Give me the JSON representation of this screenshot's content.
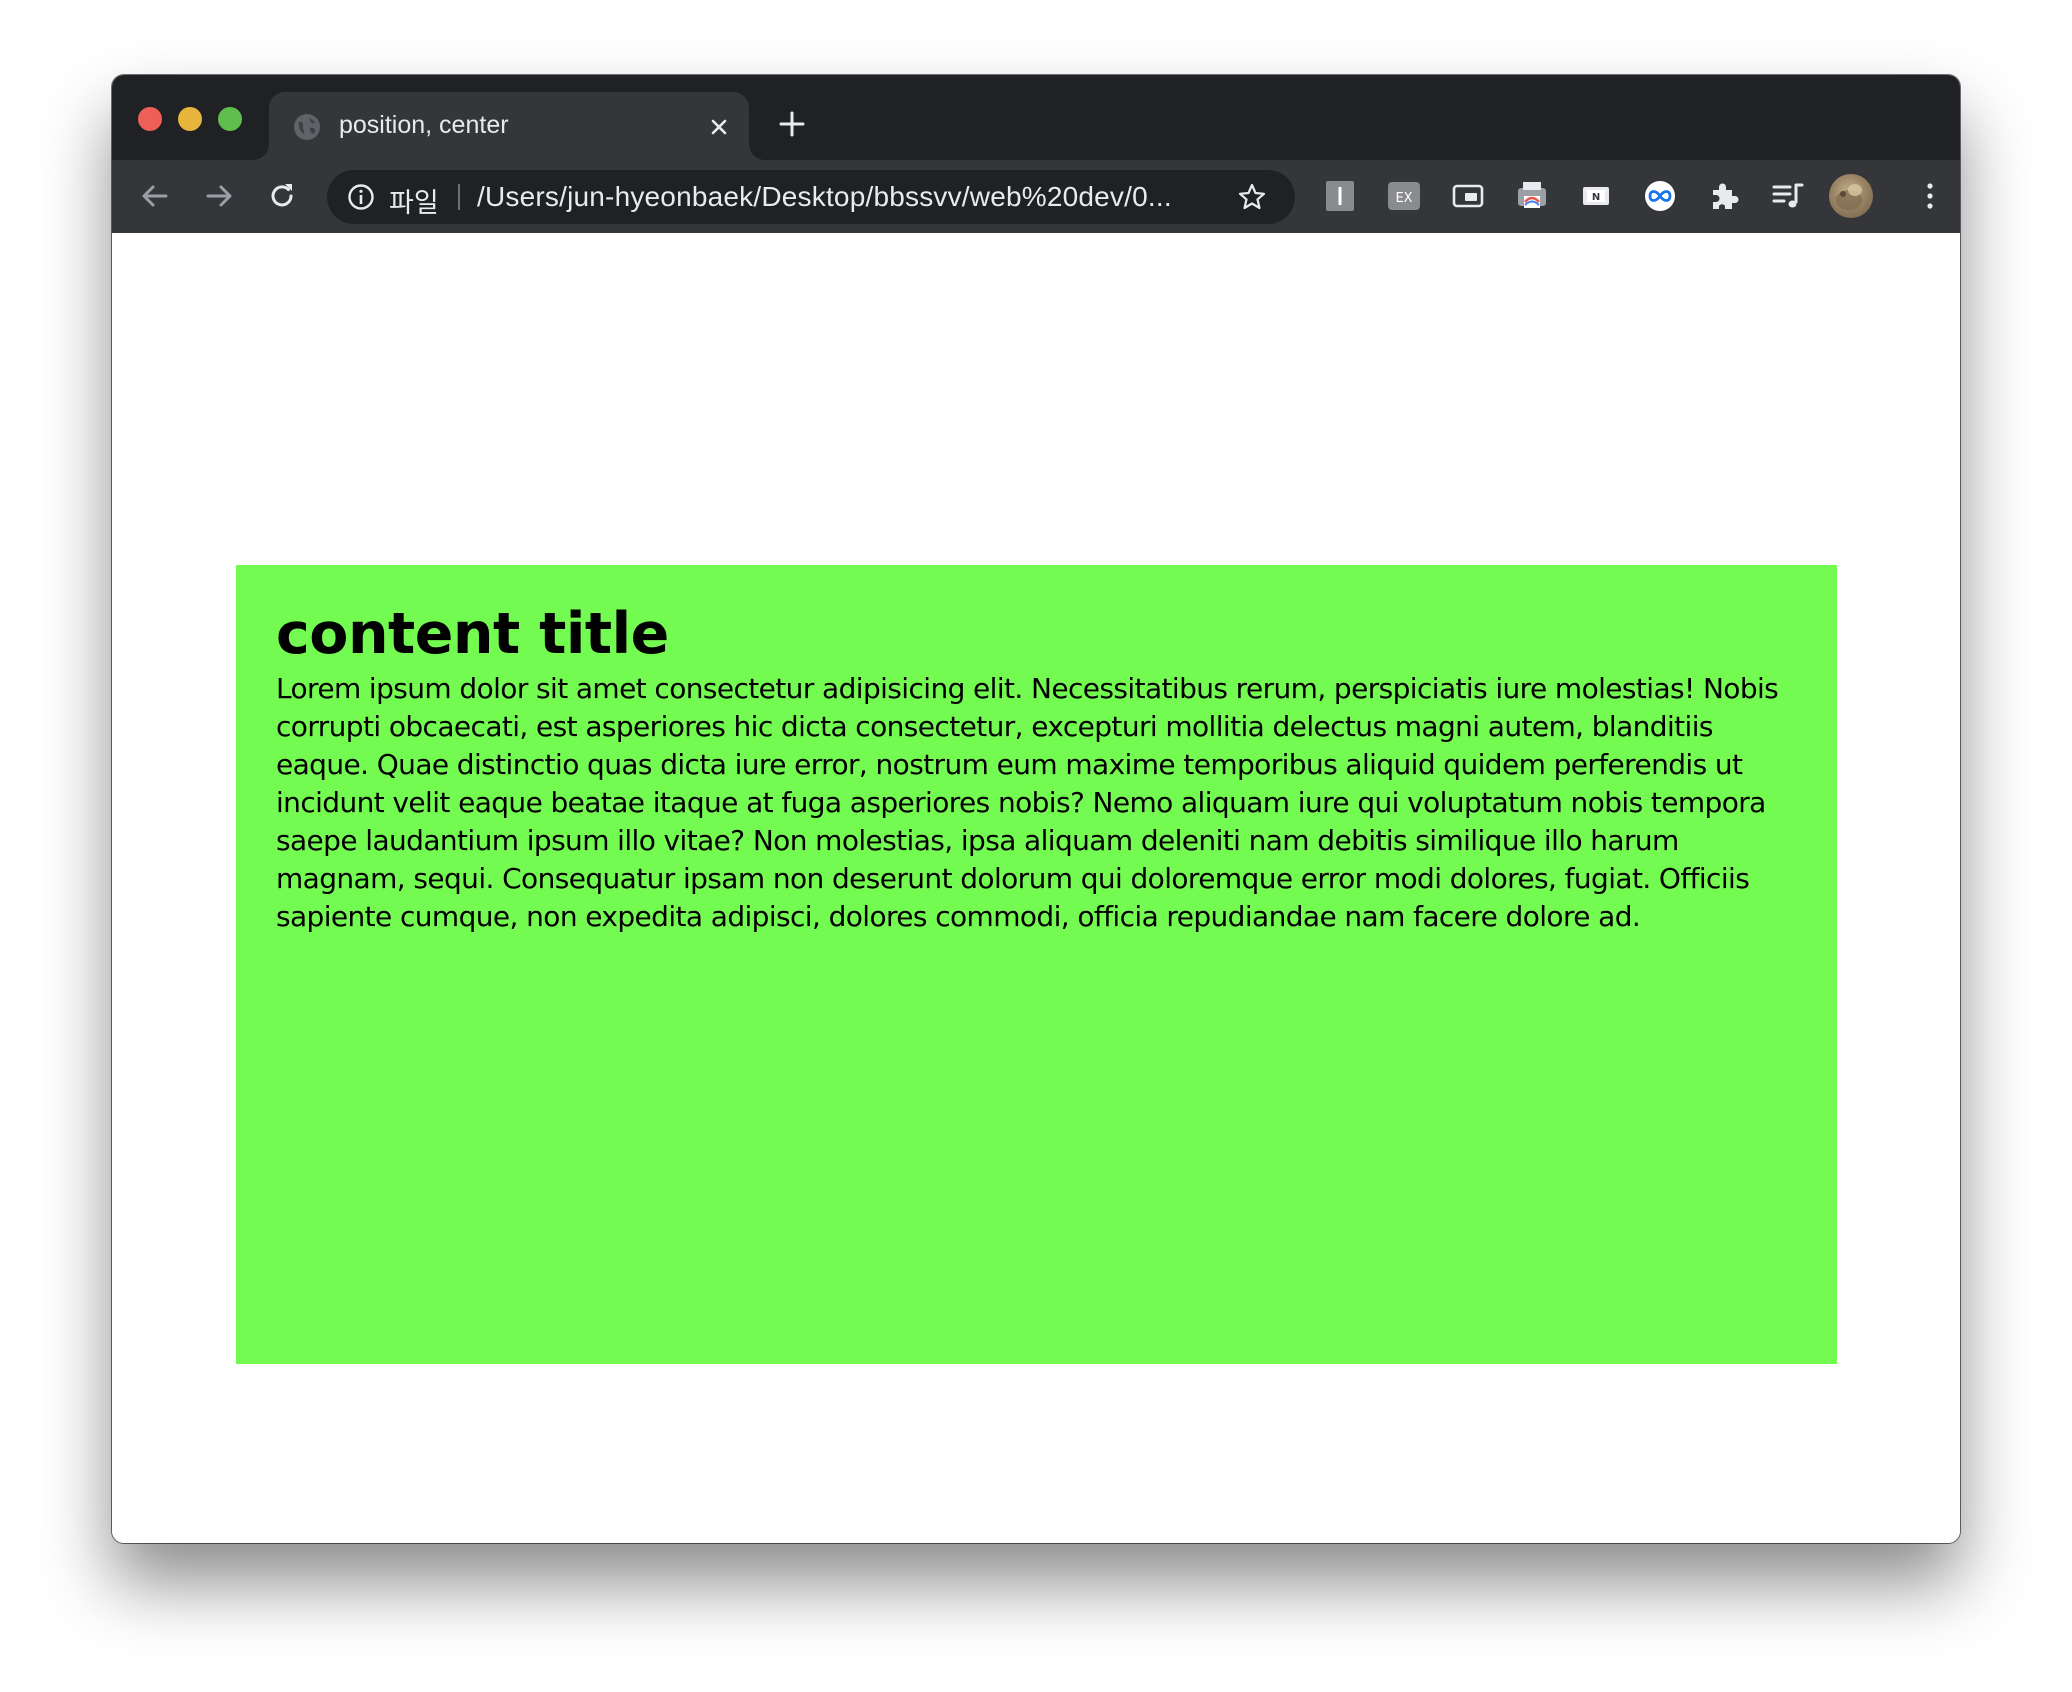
{
  "browser": {
    "tab": {
      "title": "position, center",
      "favicon": "globe-icon"
    },
    "new_tab_icon": "plus-icon",
    "nav": {
      "back_icon": "arrow-left-icon",
      "forward_icon": "arrow-right-icon",
      "reload_icon": "reload-icon"
    },
    "address_bar": {
      "info_icon": "info-icon",
      "scheme_label": "파일",
      "url": "/Users/jun-hyeonbaek/Desktop/bbssvv/web%20dev/0...",
      "bookmark_icon": "star-icon"
    },
    "extensions": [
      {
        "name": "extension-i-icon"
      },
      {
        "name": "extension-ex-icon",
        "label": "EX"
      },
      {
        "name": "picture-in-picture-icon"
      },
      {
        "name": "extension-printer-icon"
      },
      {
        "name": "extension-n-icon",
        "label": "N"
      },
      {
        "name": "extension-infinity-icon"
      },
      {
        "name": "puzzle-icon"
      },
      {
        "name": "media-queue-icon"
      }
    ],
    "profile_icon": "avatar",
    "menu_icon": "kebab-menu-icon",
    "colors": {
      "tab_strip": "#202124",
      "toolbar": "#35363a",
      "close": "#ee5f57",
      "minimize": "#e5b53c",
      "maximize": "#5fbf4d"
    }
  },
  "page": {
    "content_title": "content title",
    "content_body": "Lorem ipsum dolor sit amet consectetur adipisicing elit. Necessitatibus rerum, perspiciatis iure molestias! Nobis corrupti obcaecati, est asperiores hic dicta consectetur, excepturi mollitia delectus magni autem, blanditiis eaque. Quae distinctio quas dicta iure error, nostrum eum maxime temporibus aliquid quidem perferendis ut incidunt velit eaque beatae itaque at fuga asperiores nobis? Nemo aliquam iure qui voluptatum nobis tempora saepe laudantium ipsum illo vitae? Non molestias, ipsa aliquam deleniti nam debitis similique illo harum magnam, sequi. Consequatur ipsam non deserunt dolorum qui doloremque error modi dolores, fugiat. Officiis sapiente cumque, non expedita adipisci, dolores commodi, officia repudiandae nam facere dolore ad.",
    "box_color": "#74fb51"
  }
}
